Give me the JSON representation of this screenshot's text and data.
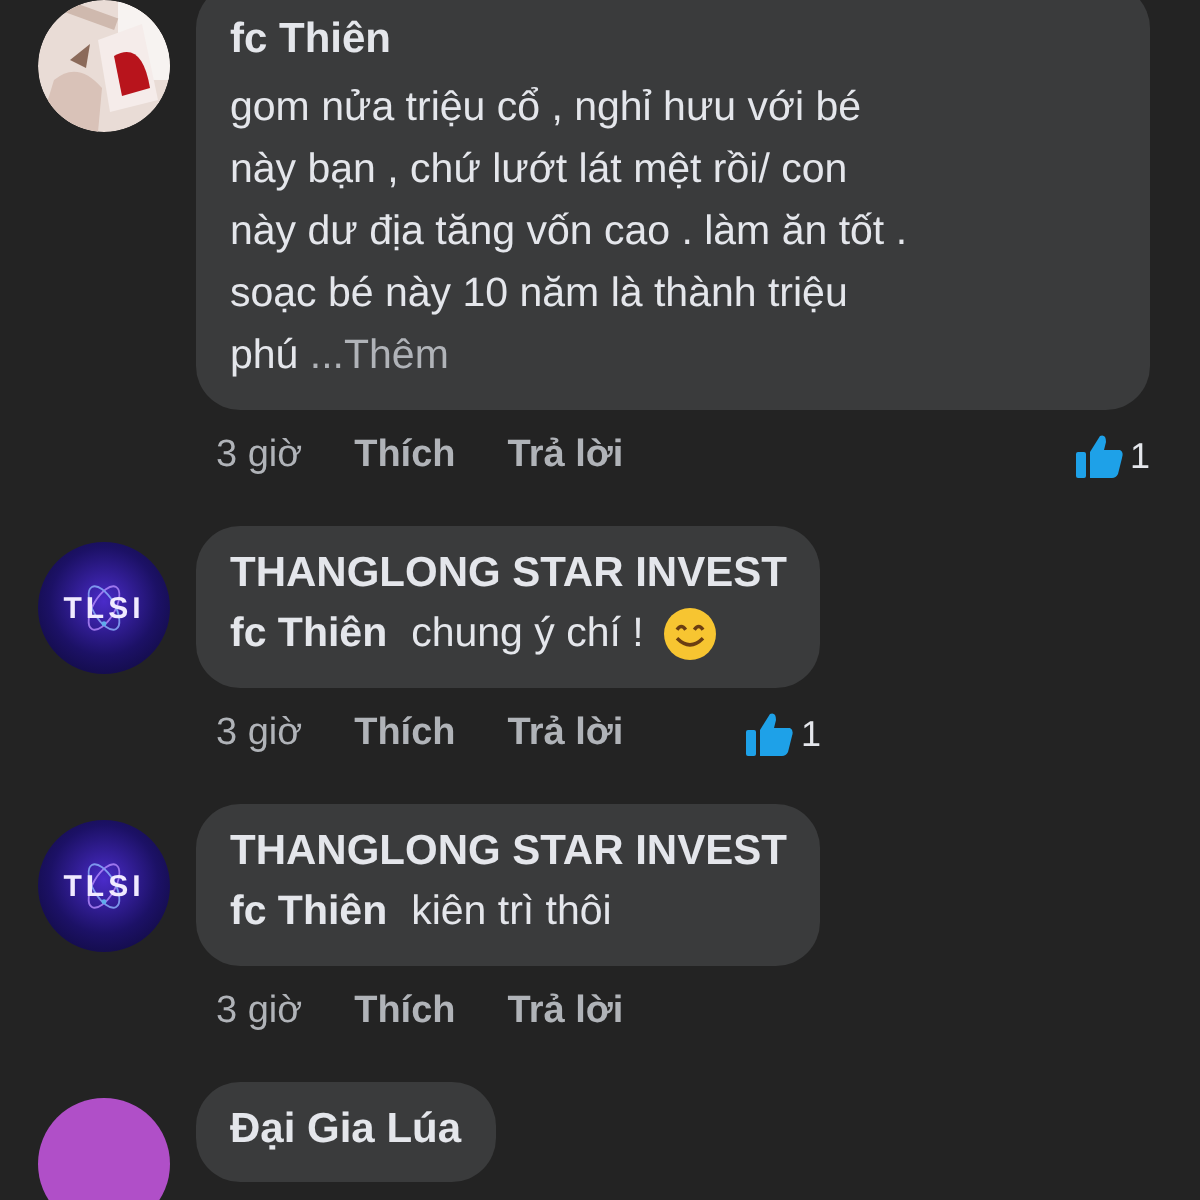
{
  "comments": [
    {
      "author": "fc Thiên",
      "text": "gom nửa triệu cổ , nghỉ hưu với bé\nnày bạn , chứ lướt lát mệt rồi/ con\nnày dư địa tăng  vốn cao . làm ăn tốt .\nsoạc bé này 10 năm là thành triệu\nphú ",
      "more": "...Thêm",
      "time": "3 giờ",
      "like_label": "Thích",
      "reply_label": "Trả lời",
      "likes": "1"
    },
    {
      "avatar": {
        "kind": "logo",
        "text": "TLSI"
      },
      "author": "THANGLONG STAR INVEST",
      "mention": "fc Thiên",
      "text": "chung ý chí !",
      "emoji": true,
      "time": "3 giờ",
      "like_label": "Thích",
      "reply_label": "Trả lời",
      "likes": "1"
    },
    {
      "avatar": {
        "kind": "logo",
        "text": "TLSI"
      },
      "author": "THANGLONG STAR INVEST",
      "mention": "fc Thiên",
      "text": "kiên trì thôi",
      "emoji": false,
      "time": "3 giờ",
      "like_label": "Thích",
      "reply_label": "Trả lời"
    },
    {
      "avatar": {
        "kind": "initial",
        "color": "#b04fc8"
      },
      "author": "Đại Gia Lúa"
    }
  ]
}
